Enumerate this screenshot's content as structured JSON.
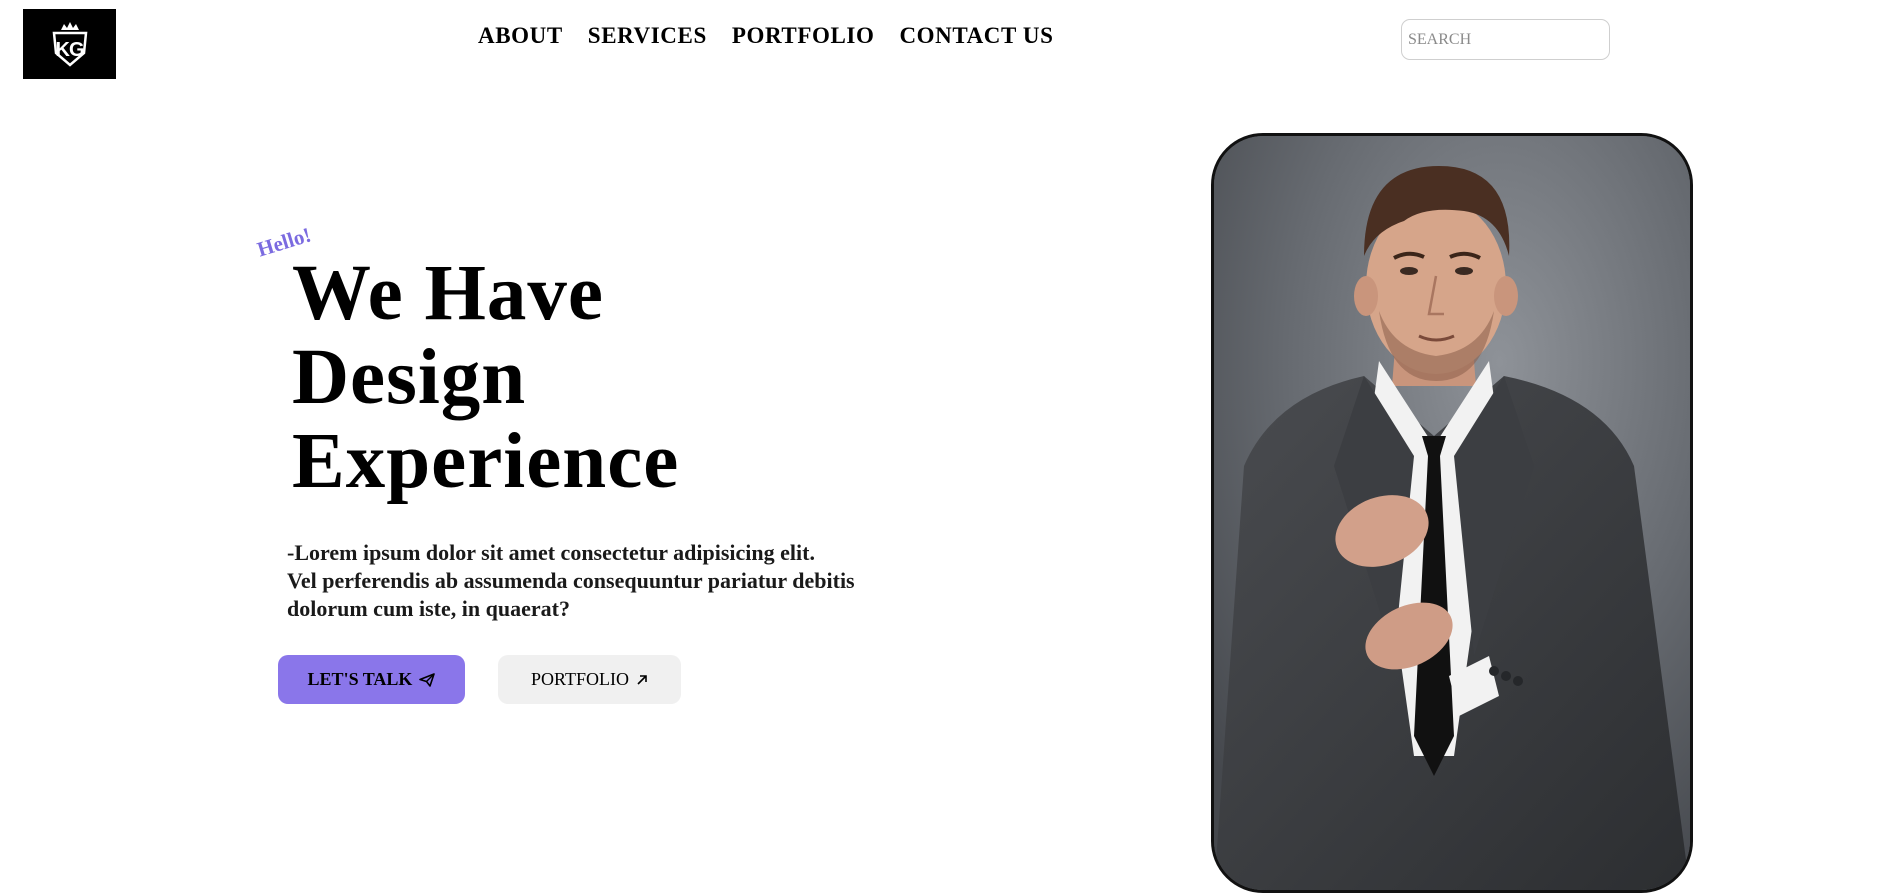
{
  "header": {
    "logo": {
      "text": "KG",
      "icon": "crown-icon"
    },
    "nav": [
      {
        "label": "ABOUT"
      },
      {
        "label": "SERVICES"
      },
      {
        "label": "PORTFOLIO"
      },
      {
        "label": "CONTACT US"
      }
    ],
    "search": {
      "placeholder": "SEARCH",
      "value": ""
    }
  },
  "hero": {
    "greeting": "Hello!",
    "headline_lines": [
      "We Have",
      "Design",
      "Experience"
    ],
    "lead_lines": [
      "-Lorem ipsum dolor sit amet consectetur adipisicing elit.",
      "Vel perferendis ab assumenda consequuntur pariatur debitis",
      "dolorum cum iste, in quaerat?"
    ],
    "buttons": {
      "talk": {
        "label": "LET'S TALK",
        "icon": "paper-plane-icon"
      },
      "portfolio": {
        "label": "PORTFOLIO",
        "icon": "arrow-up-right-icon"
      }
    },
    "photo": {
      "subject": "portrait-photo",
      "colors": {
        "background": "#6b6f75",
        "suit": "#3a3c3f",
        "shirt": "#f2f2f2",
        "tie": "#111111",
        "skin": "#d6a58a",
        "hair": "#4a2f22"
      }
    }
  },
  "colors": {
    "accent": "#8a76ea",
    "greeting": "#7b6be0",
    "secondary_button": "#f0f0f0"
  }
}
